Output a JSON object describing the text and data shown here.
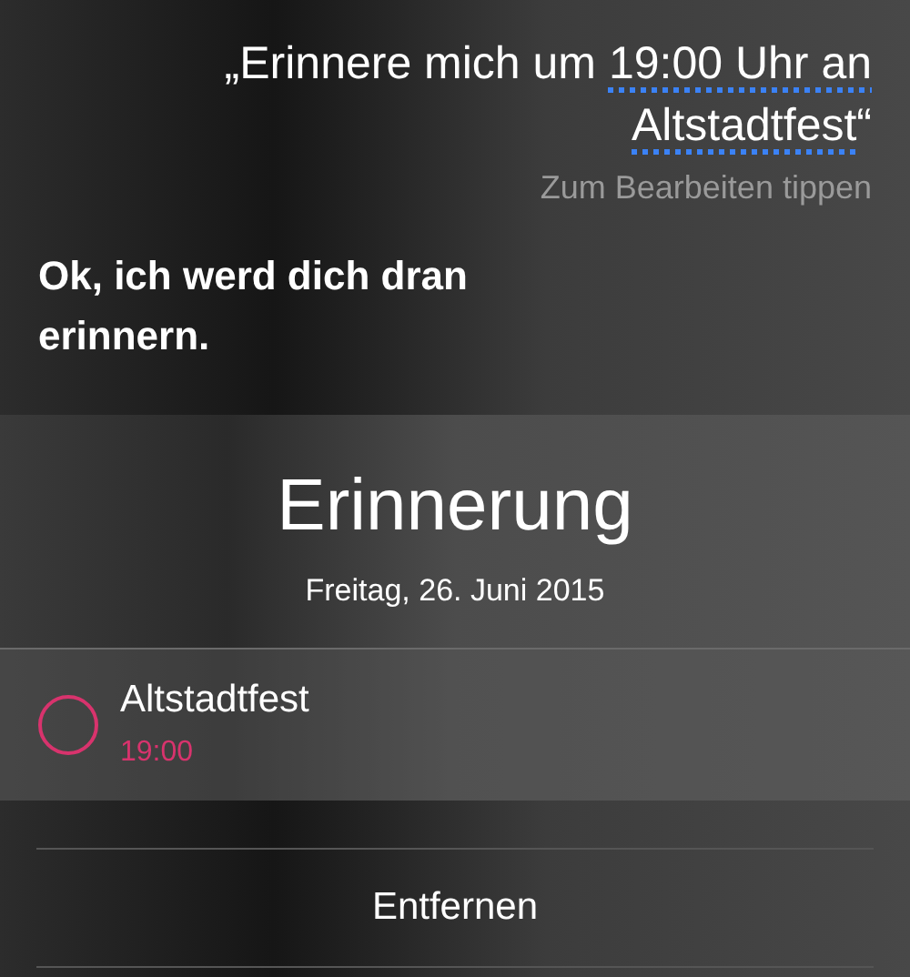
{
  "query": {
    "segments": [
      {
        "text": "„Erinnere mich um ",
        "underlined": false
      },
      {
        "text": "19:00 Uhr an Altstadtfest",
        "underlined": true
      },
      {
        "text": "“",
        "underlined": false
      }
    ]
  },
  "edit_hint": "Zum Bearbeiten tippen",
  "response": "Ok, ich werd dich dran erinnern.",
  "card": {
    "title": "Erinnerung",
    "date": "Freitag, 26. Juni 2015",
    "reminders": [
      {
        "title": "Altstadtfest",
        "time": "19:00",
        "completed": false
      }
    ]
  },
  "remove_button": "Entfernen"
}
